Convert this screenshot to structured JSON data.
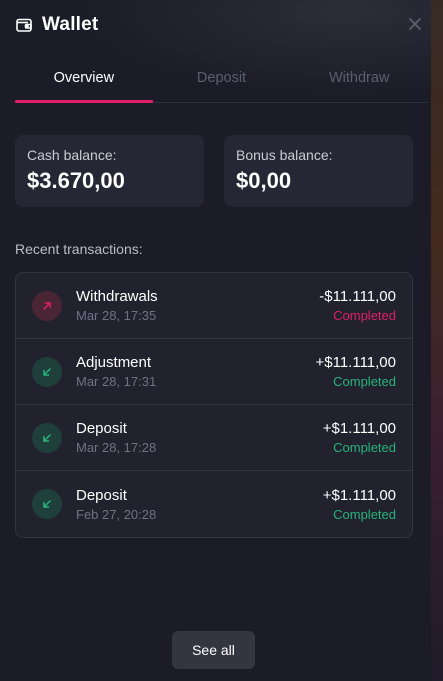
{
  "window": {
    "title": "Wallet"
  },
  "tabs": [
    {
      "label": "Overview",
      "active": true
    },
    {
      "label": "Deposit",
      "active": false
    },
    {
      "label": "Withdraw",
      "active": false
    }
  ],
  "balances": {
    "cash": {
      "label": "Cash balance:",
      "value": "$3.670,00"
    },
    "bonus": {
      "label": "Bonus balance:",
      "value": "$0,00"
    }
  },
  "recent": {
    "label": "Recent transactions:",
    "transactions": [
      {
        "name": "Withdrawals",
        "date": "Mar 28, 17:35",
        "amount": "-$11.111,00",
        "status": "Completed",
        "direction": "out",
        "icon": "arrow-up-right-icon"
      },
      {
        "name": "Adjustment",
        "date": "Mar 28, 17:31",
        "amount": "+$11.111,00",
        "status": "Completed",
        "direction": "in",
        "icon": "arrow-down-left-icon"
      },
      {
        "name": "Deposit",
        "date": "Mar 28, 17:28",
        "amount": "+$1.111,00",
        "status": "Completed",
        "direction": "in",
        "icon": "arrow-down-left-icon"
      },
      {
        "name": "Deposit",
        "date": "Feb 27, 20:28",
        "amount": "+$1.111,00",
        "status": "Completed",
        "direction": "in",
        "icon": "arrow-down-left-icon"
      }
    ]
  },
  "actions": {
    "see_all": "See all"
  },
  "colors": {
    "accent": "#e11f66",
    "success": "#27b37a",
    "background": "#1b1c27",
    "card": "#252734"
  }
}
